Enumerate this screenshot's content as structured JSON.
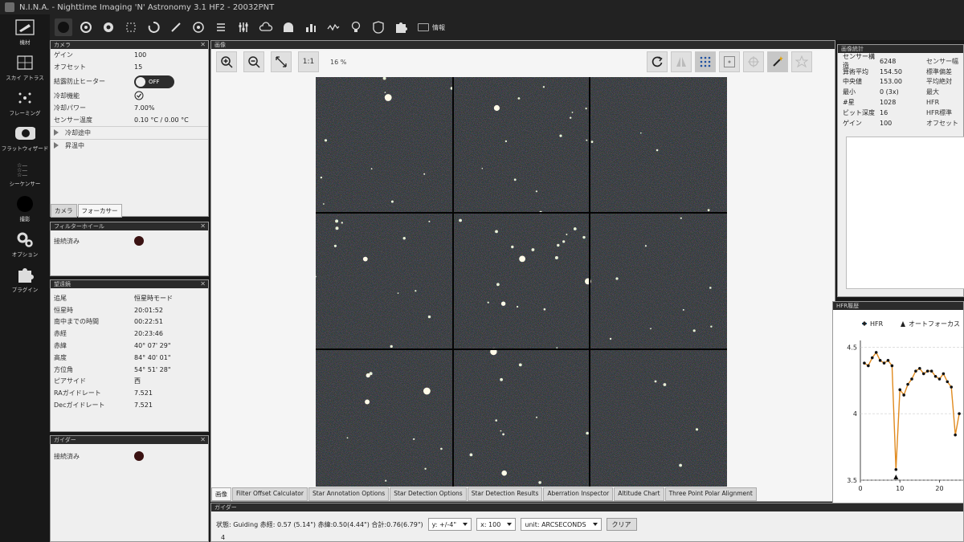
{
  "window": {
    "title": "N.I.N.A. - Nighttime Imaging 'N' Astronomy 3.1 HF2  -  20032PNT"
  },
  "nav": [
    {
      "label": "機材",
      "icon": "telescope-icon"
    },
    {
      "label": "スカイ アトラス",
      "icon": "atlas-icon"
    },
    {
      "label": "フレーミング",
      "icon": "framing-icon"
    },
    {
      "label": "フラットウィザード",
      "icon": "flat-wizard-icon"
    },
    {
      "label": "シーケンサー",
      "icon": "sequencer-icon"
    },
    {
      "label": "撮影",
      "icon": "imaging-icon"
    },
    {
      "label": "オプション",
      "icon": "gear-icon"
    },
    {
      "label": "プラグイン",
      "icon": "puzzle-icon"
    }
  ],
  "toolbar": {
    "info_label": "情報"
  },
  "camera": {
    "title": "カメラ",
    "rows": [
      {
        "k": "ゲイン",
        "v": "100"
      },
      {
        "k": "オフセット",
        "v": "15"
      }
    ],
    "heater_label": "結露防止ヒーター",
    "heater_state": "OFF",
    "rows2": [
      {
        "k": "冷却機能",
        "v": ""
      },
      {
        "k": "冷却パワー",
        "v": "7.00%"
      },
      {
        "k": "センサー温度",
        "v": "0.10 °C / 0.00 °C"
      }
    ],
    "expand1": "冷却途中",
    "expand2": "昇温中",
    "tabs": [
      "カメラ",
      "フォーカサー"
    ]
  },
  "focuser": {
    "title": "フィルターホイール",
    "status": "接続済み"
  },
  "telescope": {
    "title": "望遠鏡",
    "rows": [
      {
        "k": "追尾",
        "v": "恒星時モード"
      },
      {
        "k": "恒星時",
        "v": "20:01:52"
      },
      {
        "k": "南中までの時間",
        "v": "00:22:51"
      },
      {
        "k": "赤経",
        "v": "20:23:46"
      },
      {
        "k": "赤緯",
        "v": "40° 07' 29\""
      },
      {
        "k": "高度",
        "v": "84° 40' 01\""
      },
      {
        "k": "方位角",
        "v": "54° 51' 28\""
      },
      {
        "k": "ピアサイド",
        "v": "西"
      },
      {
        "k": "RAガイドレート",
        "v": "7.521"
      },
      {
        "k": "Decガイドレート",
        "v": "7.521"
      }
    ]
  },
  "rotator": {
    "title": "ガイダー",
    "status": "接続済み"
  },
  "image": {
    "title": "画像",
    "zoom_1to1": "1:1",
    "zoom_percent": "16 %",
    "tabs": [
      "画像",
      "Filter Offset Calculator",
      "Star Annotation Options",
      "Star Detection Options",
      "Star Detection Results",
      "Aberration Inspector",
      "Altitude Chart",
      "Three Point Polar Alignment"
    ]
  },
  "stats": {
    "title": "画像統計",
    "rows": [
      {
        "k": "センサー構造",
        "v": "6248",
        "k2": "センサー幅"
      },
      {
        "k": "算術平均",
        "v": "154.50",
        "k2": "標準偏差"
      },
      {
        "k": "中央値",
        "v": "153.00",
        "k2": "平均絶対"
      },
      {
        "k": "最小",
        "v": "0 (3x)",
        "k2": "最大"
      },
      {
        "k": "#星",
        "v": "1028",
        "k2": "HFR"
      },
      {
        "k": "ビット深度",
        "v": "16",
        "k2": "HFR標準"
      },
      {
        "k": "ゲイン",
        "v": "100",
        "k2": "オフセット"
      }
    ]
  },
  "hfr": {
    "title": "HFR履歴",
    "legend_hfr": "HFR",
    "legend_af": "オートフォーカス"
  },
  "chart_data": {
    "type": "line",
    "series": [
      {
        "name": "HFR",
        "x": [
          1,
          2,
          3,
          4,
          5,
          6,
          7,
          8,
          9,
          10,
          11,
          12,
          13,
          14,
          15,
          16,
          17,
          18,
          19,
          20,
          21,
          22,
          23,
          24,
          25
        ],
        "values": [
          4.38,
          4.36,
          4.42,
          4.46,
          4.4,
          4.38,
          4.4,
          4.36,
          3.58,
          4.18,
          4.14,
          4.22,
          4.26,
          4.32,
          4.34,
          4.3,
          4.32,
          4.32,
          4.28,
          4.26,
          4.3,
          4.24,
          4.2,
          3.84,
          4.0
        ]
      }
    ],
    "autofocus_x": [
      9
    ],
    "xticks": [
      "0",
      "10",
      "20"
    ],
    "yticks": [
      "3.5",
      "4",
      "4.5"
    ],
    "ylim": [
      3.5,
      4.55
    ],
    "xlim": [
      0,
      26
    ],
    "grid": true
  },
  "guider": {
    "title": "ガイダー",
    "status": "状態: Guiding 赤経: 0.57 (5.14\") 赤緯:0.50(4.44\") 合計:0.76(6.79\")",
    "y_sel": "y: +/-4\"",
    "x_sel": "x: 100",
    "unit_sel": "unit: ARCSECONDS",
    "clear": "クリア",
    "axis_top": "4"
  }
}
